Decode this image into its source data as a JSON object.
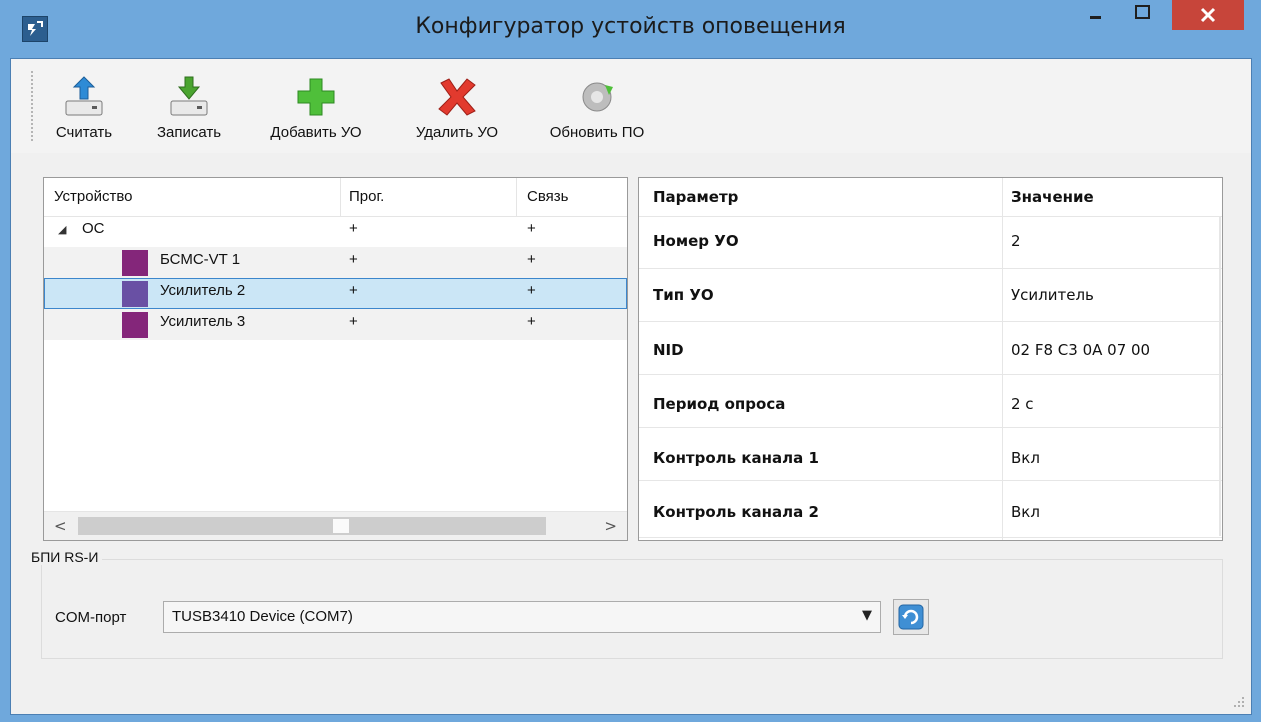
{
  "window": {
    "title": "Конфигуратор устойств оповещения"
  },
  "toolbar": {
    "buttons": [
      {
        "label": "Считать",
        "icon": "upload-icon"
      },
      {
        "label": "Записать",
        "icon": "download-icon"
      },
      {
        "label": "Добавить УО",
        "icon": "plus-icon"
      },
      {
        "label": "Удалить УО",
        "icon": "delete-x-icon"
      },
      {
        "label": "Обновить ПО",
        "icon": "update-firmware-icon"
      }
    ]
  },
  "tree": {
    "headers": [
      "Устройство",
      "Прог.",
      "Связь"
    ],
    "rows": [
      {
        "name": "ОС",
        "prog": "+",
        "link": "+"
      },
      {
        "name": "БСМС-VT 1",
        "prog": "+",
        "link": "+"
      },
      {
        "name": "Усилитель 2",
        "prog": "+",
        "link": "+"
      },
      {
        "name": "Усилитель 3",
        "prog": "+",
        "link": "+"
      }
    ]
  },
  "params": {
    "headers": [
      "Параметр",
      "Значение"
    ],
    "rows": [
      {
        "name": "Номер УО",
        "value": "2"
      },
      {
        "name": "Тип УО",
        "value": "Усилитель"
      },
      {
        "name": "NID",
        "value": "02 F8 C3 0A 07 00"
      },
      {
        "name": "Период опроса",
        "value": "2 с"
      },
      {
        "name": "Контроль канала 1",
        "value": "Вкл"
      },
      {
        "name": "Контроль канала 2",
        "value": "Вкл"
      }
    ]
  },
  "bpi": {
    "group_label": "БПИ RS-И",
    "com_label": "COM-порт",
    "com_value": "TUSB3410 Device (COM7)"
  },
  "colors": {
    "device_icon": "#84267a",
    "selection": "#cbe6f6",
    "close_button": "#c7453a",
    "frame": "#6fa8dc"
  }
}
